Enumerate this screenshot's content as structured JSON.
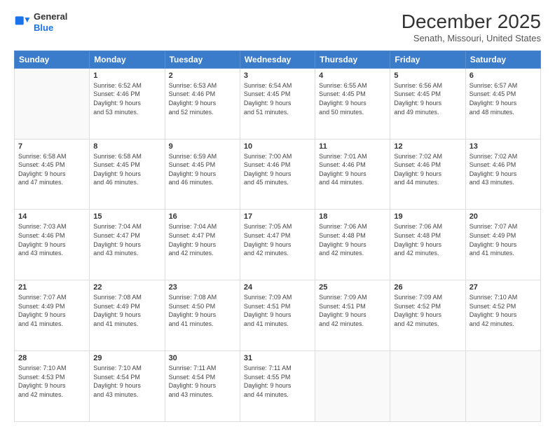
{
  "header": {
    "logo_line1": "General",
    "logo_line2": "Blue",
    "title": "December 2025",
    "subtitle": "Senath, Missouri, United States"
  },
  "days_of_week": [
    "Sunday",
    "Monday",
    "Tuesday",
    "Wednesday",
    "Thursday",
    "Friday",
    "Saturday"
  ],
  "weeks": [
    [
      {
        "day": "",
        "info": ""
      },
      {
        "day": "1",
        "info": "Sunrise: 6:52 AM\nSunset: 4:46 PM\nDaylight: 9 hours\nand 53 minutes."
      },
      {
        "day": "2",
        "info": "Sunrise: 6:53 AM\nSunset: 4:46 PM\nDaylight: 9 hours\nand 52 minutes."
      },
      {
        "day": "3",
        "info": "Sunrise: 6:54 AM\nSunset: 4:45 PM\nDaylight: 9 hours\nand 51 minutes."
      },
      {
        "day": "4",
        "info": "Sunrise: 6:55 AM\nSunset: 4:45 PM\nDaylight: 9 hours\nand 50 minutes."
      },
      {
        "day": "5",
        "info": "Sunrise: 6:56 AM\nSunset: 4:45 PM\nDaylight: 9 hours\nand 49 minutes."
      },
      {
        "day": "6",
        "info": "Sunrise: 6:57 AM\nSunset: 4:45 PM\nDaylight: 9 hours\nand 48 minutes."
      }
    ],
    [
      {
        "day": "7",
        "info": "Sunrise: 6:58 AM\nSunset: 4:45 PM\nDaylight: 9 hours\nand 47 minutes."
      },
      {
        "day": "8",
        "info": "Sunrise: 6:58 AM\nSunset: 4:45 PM\nDaylight: 9 hours\nand 46 minutes."
      },
      {
        "day": "9",
        "info": "Sunrise: 6:59 AM\nSunset: 4:45 PM\nDaylight: 9 hours\nand 46 minutes."
      },
      {
        "day": "10",
        "info": "Sunrise: 7:00 AM\nSunset: 4:46 PM\nDaylight: 9 hours\nand 45 minutes."
      },
      {
        "day": "11",
        "info": "Sunrise: 7:01 AM\nSunset: 4:46 PM\nDaylight: 9 hours\nand 44 minutes."
      },
      {
        "day": "12",
        "info": "Sunrise: 7:02 AM\nSunset: 4:46 PM\nDaylight: 9 hours\nand 44 minutes."
      },
      {
        "day": "13",
        "info": "Sunrise: 7:02 AM\nSunset: 4:46 PM\nDaylight: 9 hours\nand 43 minutes."
      }
    ],
    [
      {
        "day": "14",
        "info": "Sunrise: 7:03 AM\nSunset: 4:46 PM\nDaylight: 9 hours\nand 43 minutes."
      },
      {
        "day": "15",
        "info": "Sunrise: 7:04 AM\nSunset: 4:47 PM\nDaylight: 9 hours\nand 43 minutes."
      },
      {
        "day": "16",
        "info": "Sunrise: 7:04 AM\nSunset: 4:47 PM\nDaylight: 9 hours\nand 42 minutes."
      },
      {
        "day": "17",
        "info": "Sunrise: 7:05 AM\nSunset: 4:47 PM\nDaylight: 9 hours\nand 42 minutes."
      },
      {
        "day": "18",
        "info": "Sunrise: 7:06 AM\nSunset: 4:48 PM\nDaylight: 9 hours\nand 42 minutes."
      },
      {
        "day": "19",
        "info": "Sunrise: 7:06 AM\nSunset: 4:48 PM\nDaylight: 9 hours\nand 42 minutes."
      },
      {
        "day": "20",
        "info": "Sunrise: 7:07 AM\nSunset: 4:49 PM\nDaylight: 9 hours\nand 41 minutes."
      }
    ],
    [
      {
        "day": "21",
        "info": "Sunrise: 7:07 AM\nSunset: 4:49 PM\nDaylight: 9 hours\nand 41 minutes."
      },
      {
        "day": "22",
        "info": "Sunrise: 7:08 AM\nSunset: 4:49 PM\nDaylight: 9 hours\nand 41 minutes."
      },
      {
        "day": "23",
        "info": "Sunrise: 7:08 AM\nSunset: 4:50 PM\nDaylight: 9 hours\nand 41 minutes."
      },
      {
        "day": "24",
        "info": "Sunrise: 7:09 AM\nSunset: 4:51 PM\nDaylight: 9 hours\nand 41 minutes."
      },
      {
        "day": "25",
        "info": "Sunrise: 7:09 AM\nSunset: 4:51 PM\nDaylight: 9 hours\nand 42 minutes."
      },
      {
        "day": "26",
        "info": "Sunrise: 7:09 AM\nSunset: 4:52 PM\nDaylight: 9 hours\nand 42 minutes."
      },
      {
        "day": "27",
        "info": "Sunrise: 7:10 AM\nSunset: 4:52 PM\nDaylight: 9 hours\nand 42 minutes."
      }
    ],
    [
      {
        "day": "28",
        "info": "Sunrise: 7:10 AM\nSunset: 4:53 PM\nDaylight: 9 hours\nand 42 minutes."
      },
      {
        "day": "29",
        "info": "Sunrise: 7:10 AM\nSunset: 4:54 PM\nDaylight: 9 hours\nand 43 minutes."
      },
      {
        "day": "30",
        "info": "Sunrise: 7:11 AM\nSunset: 4:54 PM\nDaylight: 9 hours\nand 43 minutes."
      },
      {
        "day": "31",
        "info": "Sunrise: 7:11 AM\nSunset: 4:55 PM\nDaylight: 9 hours\nand 44 minutes."
      },
      {
        "day": "",
        "info": ""
      },
      {
        "day": "",
        "info": ""
      },
      {
        "day": "",
        "info": ""
      }
    ]
  ]
}
